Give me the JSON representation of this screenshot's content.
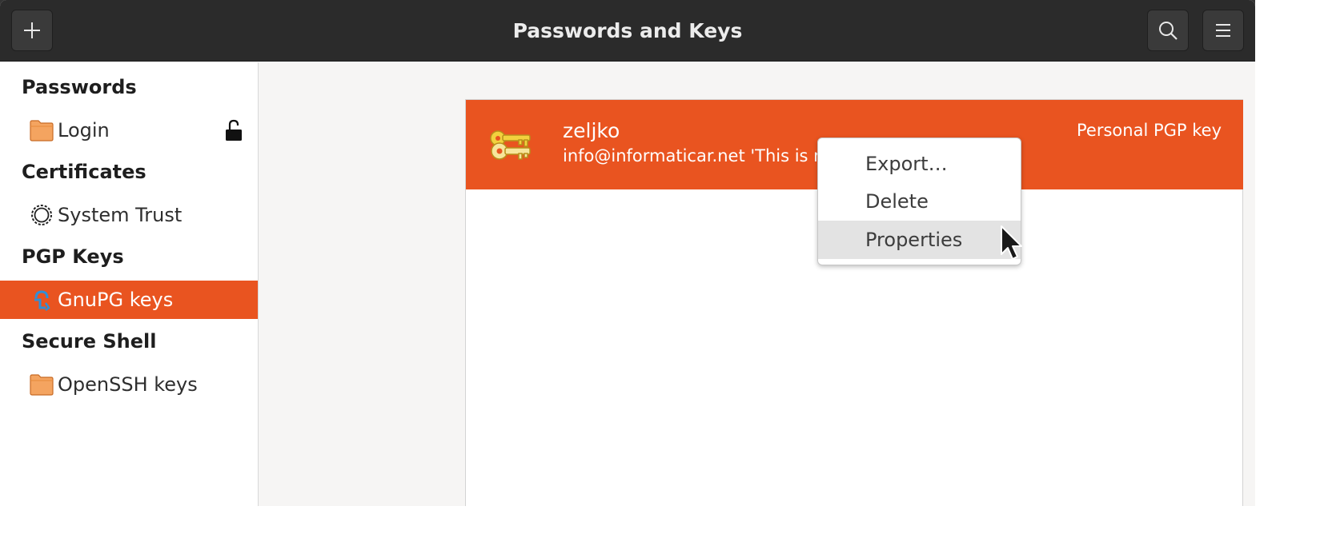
{
  "window": {
    "title": "Passwords and Keys"
  },
  "headerbar": {
    "new_button_icon": "plus-icon",
    "search_button_icon": "search-icon",
    "menu_button_icon": "hamburger-menu-icon"
  },
  "sidebar": {
    "sections": [
      {
        "header": "Passwords",
        "items": [
          {
            "label": "Login",
            "icon": "folder-icon",
            "locked": true,
            "lock_icon": "unlocked-padlock-icon"
          }
        ]
      },
      {
        "header": "Certificates",
        "items": [
          {
            "label": "System Trust",
            "icon": "certificate-seal-icon"
          }
        ]
      },
      {
        "header": "PGP Keys",
        "items": [
          {
            "label": "GnuPG keys",
            "icon": "gnupg-key-icon",
            "selected": true
          }
        ]
      },
      {
        "header": "Secure Shell",
        "items": [
          {
            "label": "OpenSSH keys",
            "icon": "folder-icon"
          }
        ]
      }
    ]
  },
  "key_list": {
    "rows": [
      {
        "name": "zeljko",
        "description": "info@informaticar.net 'This is n… …na…",
        "type": "Personal PGP key",
        "icon": "keys-icon",
        "selected": true
      }
    ]
  },
  "context_menu": {
    "items": [
      {
        "label": "Export…"
      },
      {
        "label": "Delete"
      },
      {
        "label": "Properties",
        "hover": true
      }
    ]
  },
  "colors": {
    "accent": "#e95420",
    "headerbar": "#2b2b2b",
    "sidebar_bg": "#ffffff",
    "content_bg": "#f6f5f4"
  }
}
